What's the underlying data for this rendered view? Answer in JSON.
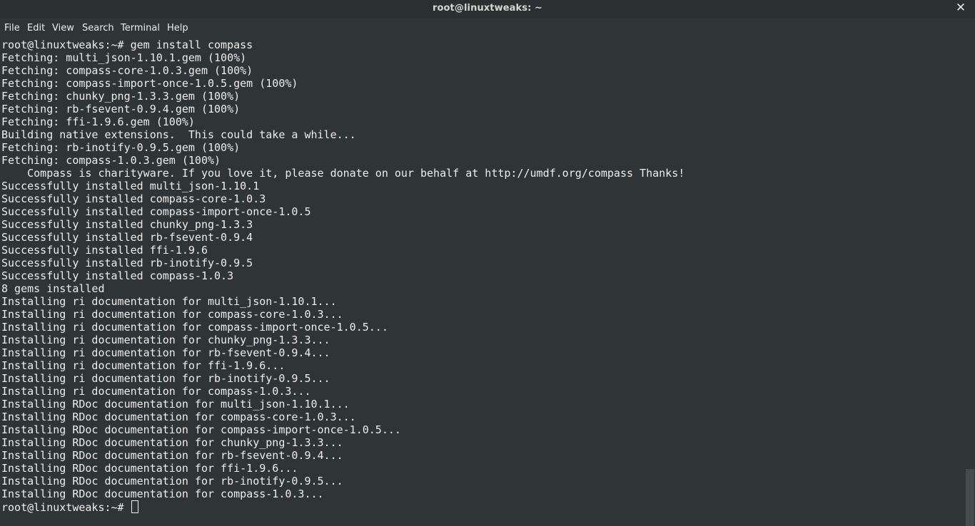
{
  "window": {
    "title": "root@linuxtweaks: ~",
    "close_glyph": "✕"
  },
  "menubar": {
    "items": [
      "File",
      "Edit",
      "View",
      "Search",
      "Terminal",
      "Help"
    ]
  },
  "terminal": {
    "lines": [
      "root@linuxtweaks:~# gem install compass",
      "Fetching: multi_json-1.10.1.gem (100%)",
      "Fetching: compass-core-1.0.3.gem (100%)",
      "Fetching: compass-import-once-1.0.5.gem (100%)",
      "Fetching: chunky_png-1.3.3.gem (100%)",
      "Fetching: rb-fsevent-0.9.4.gem (100%)",
      "Fetching: ffi-1.9.6.gem (100%)",
      "Building native extensions.  This could take a while...",
      "Fetching: rb-inotify-0.9.5.gem (100%)",
      "Fetching: compass-1.0.3.gem (100%)",
      "    Compass is charityware. If you love it, please donate on our behalf at http://umdf.org/compass Thanks!",
      "Successfully installed multi_json-1.10.1",
      "Successfully installed compass-core-1.0.3",
      "Successfully installed compass-import-once-1.0.5",
      "Successfully installed chunky_png-1.3.3",
      "Successfully installed rb-fsevent-0.9.4",
      "Successfully installed ffi-1.9.6",
      "Successfully installed rb-inotify-0.9.5",
      "Successfully installed compass-1.0.3",
      "8 gems installed",
      "Installing ri documentation for multi_json-1.10.1...",
      "Installing ri documentation for compass-core-1.0.3...",
      "Installing ri documentation for compass-import-once-1.0.5...",
      "Installing ri documentation for chunky_png-1.3.3...",
      "Installing ri documentation for rb-fsevent-0.9.4...",
      "Installing ri documentation for ffi-1.9.6...",
      "Installing ri documentation for rb-inotify-0.9.5...",
      "Installing ri documentation for compass-1.0.3...",
      "Installing RDoc documentation for multi_json-1.10.1...",
      "Installing RDoc documentation for compass-core-1.0.3...",
      "Installing RDoc documentation for compass-import-once-1.0.5...",
      "Installing RDoc documentation for chunky_png-1.3.3...",
      "Installing RDoc documentation for rb-fsevent-0.9.4...",
      "Installing RDoc documentation for ffi-1.9.6...",
      "Installing RDoc documentation for rb-inotify-0.9.5...",
      "Installing RDoc documentation for compass-1.0.3..."
    ],
    "prompt": "root@linuxtweaks:~# "
  },
  "colors": {
    "background": "#2f3436",
    "foreground": "#eeeeec"
  }
}
